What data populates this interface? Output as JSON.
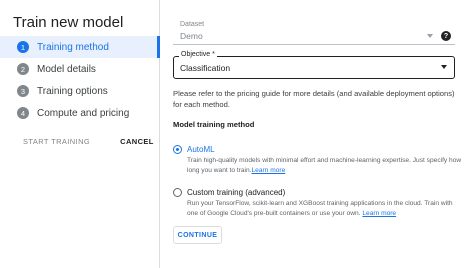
{
  "page": {
    "title": "Train new model"
  },
  "steps": [
    {
      "number": "1",
      "label": "Training method",
      "active": true
    },
    {
      "number": "2",
      "label": "Model details",
      "active": false
    },
    {
      "number": "3",
      "label": "Training options",
      "active": false
    },
    {
      "number": "4",
      "label": "Compute and pricing",
      "active": false
    }
  ],
  "left_actions": {
    "start_label": "START TRAINING",
    "cancel_label": "CANCEL"
  },
  "dataset": {
    "label": "Dataset",
    "value": "Demo"
  },
  "help_icon": "help-icon",
  "objective": {
    "label": "Objective *",
    "value": "Classification"
  },
  "pricing_text": "Please refer to the pricing guide for more details (and available deployment options) for each method.",
  "training_method": {
    "section_title": "Model training method",
    "options": [
      {
        "title": "AutoML",
        "description": "Train high-quality models with minimal effort and machine-learning expertise. Just specify how long you want to train.",
        "link": "Learn more",
        "selected": true
      },
      {
        "title": "Custom training (advanced)",
        "description": "Run your TensorFlow, scikit-learn and XGBoost training applications in the cloud. Train with one of Google Cloud's pre-built containers or use your own.",
        "link": "Learn more",
        "selected": false
      }
    ]
  },
  "continue_label": "CONTINUE",
  "colors": {
    "accent": "#1a73e8",
    "active_bg": "#e8f0fe",
    "text": "#202124",
    "muted": "#5f6368"
  }
}
